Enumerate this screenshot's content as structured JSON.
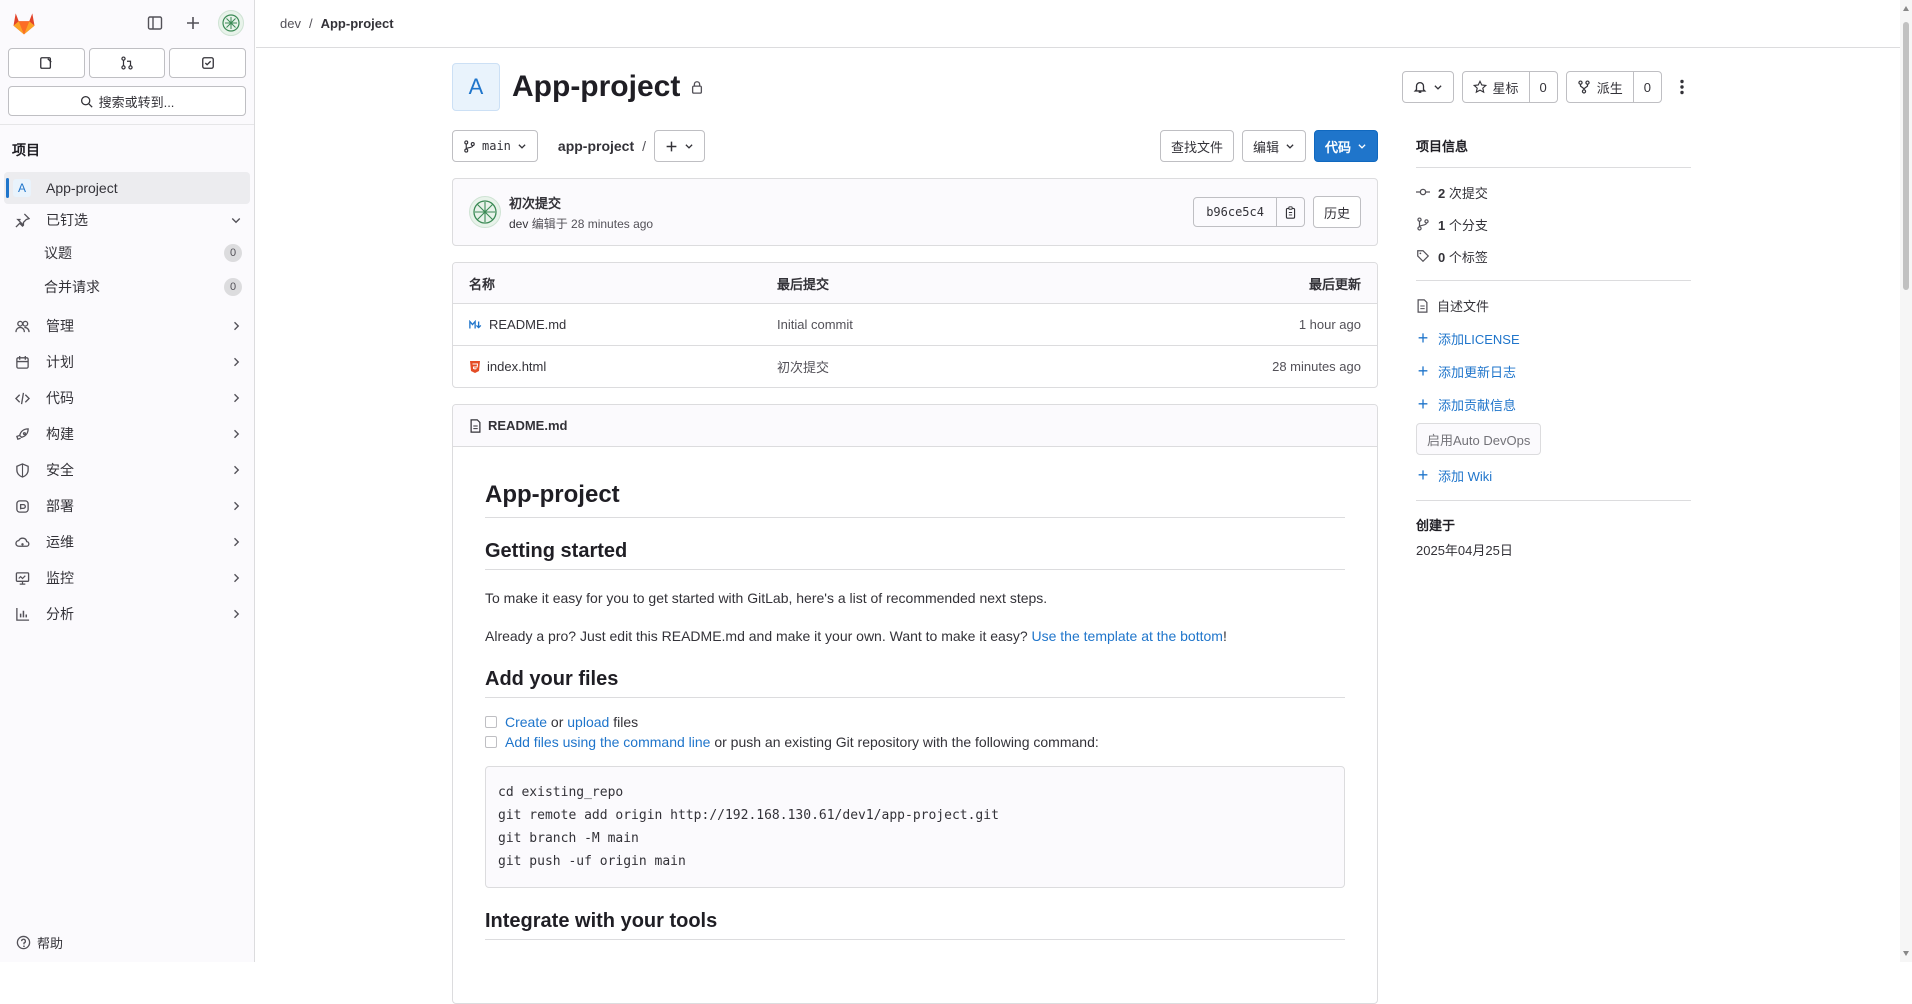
{
  "breadcrumb": {
    "group": "dev",
    "project": "App-project"
  },
  "sidebar": {
    "search": "搜索或转到...",
    "section_title": "项目",
    "project_item": {
      "initial": "A",
      "label": "App-project"
    },
    "pinned": {
      "label": "已钉选",
      "items": [
        {
          "label": "议题",
          "count": "0"
        },
        {
          "label": "合并请求",
          "count": "0"
        }
      ]
    },
    "menu": [
      {
        "label": "管理",
        "icon": "users-icon"
      },
      {
        "label": "计划",
        "icon": "calendar-icon"
      },
      {
        "label": "代码",
        "icon": "code-icon"
      },
      {
        "label": "构建",
        "icon": "rocket-icon"
      },
      {
        "label": "安全",
        "icon": "shield-icon"
      },
      {
        "label": "部署",
        "icon": "deploy-icon"
      },
      {
        "label": "运维",
        "icon": "cloud-icon"
      },
      {
        "label": "监控",
        "icon": "monitor-icon"
      },
      {
        "label": "分析",
        "icon": "chart-icon"
      }
    ],
    "help": "帮助"
  },
  "project": {
    "initial": "A",
    "title": "App-project",
    "star_label": "星标",
    "star_count": "0",
    "fork_label": "派生",
    "fork_count": "0"
  },
  "repo": {
    "branch": "main",
    "path": "app-project",
    "find_file": "查找文件",
    "edit": "编辑",
    "code": "代码"
  },
  "commit": {
    "title": "初次提交",
    "author": "dev",
    "meta": "编辑于 28 minutes ago",
    "sha": "b96ce5c4",
    "history": "历史"
  },
  "files": {
    "headers": {
      "name": "名称",
      "last_commit": "最后提交",
      "last_update": "最后更新"
    },
    "rows": [
      {
        "name": "README.md",
        "commit": "Initial commit",
        "updated": "1 hour ago"
      },
      {
        "name": "index.html",
        "commit": "初次提交",
        "updated": "28 minutes ago"
      }
    ]
  },
  "readme": {
    "filename": "README.md",
    "h1": "App-project",
    "h2_started": "Getting started",
    "p1": "To make it easy for you to get started with GitLab, here's a list of recommended next steps.",
    "p2_text": "Already a pro? Just edit this README.md and make it your own. Want to make it easy? ",
    "p2_link": "Use the template at the bottom",
    "p2_end": "!",
    "h2_files": "Add your files",
    "task1": {
      "link1": "Create",
      "mid": " or ",
      "link2": "upload",
      "end": " files"
    },
    "task2": {
      "link": "Add files using the command line",
      "end": " or push an existing Git repository with the following command:"
    },
    "code": "cd existing_repo\ngit remote add origin http://192.168.130.61/dev1/app-project.git\ngit branch -M main\ngit push -uf origin main",
    "h2_tools": "Integrate with your tools"
  },
  "info": {
    "title": "项目信息",
    "commits_count": "2",
    "commits_label": "次提交",
    "branches_count": "1",
    "branches_label": "个分支",
    "tags_count": "0",
    "tags_label": "个标签",
    "readme_link": "自述文件",
    "add_license": "添加LICENSE",
    "add_changelog": "添加更新日志",
    "add_contributing": "添加贡献信息",
    "auto_devops": "启用Auto DevOps",
    "add_wiki": "添加 Wiki",
    "created_label": "创建于",
    "created_date": "2025年04月25日"
  },
  "colors": {
    "accent": "#1f75cb",
    "brand": "#e24329"
  }
}
